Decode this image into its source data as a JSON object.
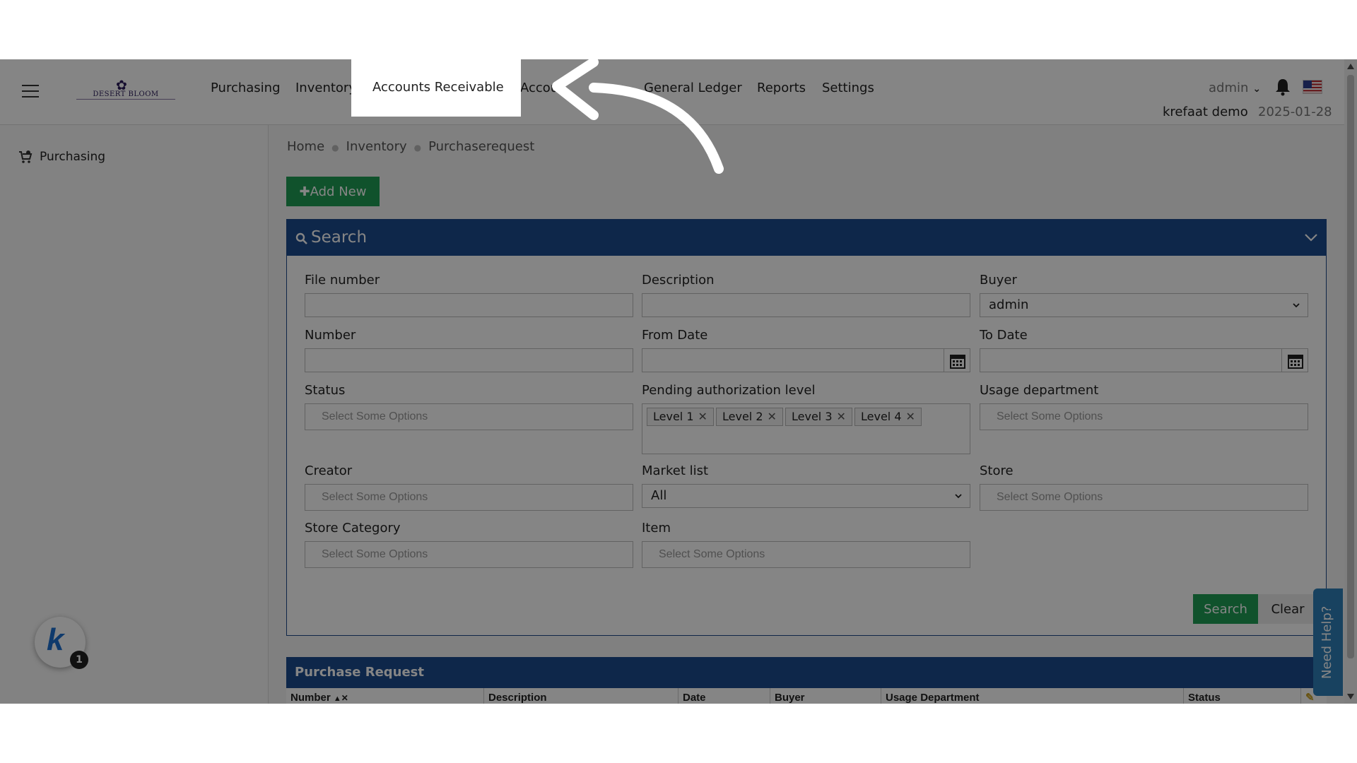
{
  "topbar": {
    "logo_text": "DESERT BLOOM",
    "nav": [
      "Purchasing",
      "Inventory",
      "Accounts Receivable",
      "Accou",
      "General Ledger",
      "Reports",
      "Settings"
    ],
    "highlighted": "Accounts Receivable",
    "user": "admin",
    "company": "krefaat demo",
    "date": "2025-01-28"
  },
  "sidebar": {
    "items": [
      {
        "label": "Purchasing",
        "icon": "cart-icon"
      }
    ]
  },
  "breadcrumb": [
    "Home",
    "Inventory",
    "Purchaserequest"
  ],
  "add_new_label": "Add New",
  "search": {
    "title": "Search",
    "fields": {
      "file_number": {
        "label": "File number",
        "value": ""
      },
      "description": {
        "label": "Description",
        "value": ""
      },
      "buyer": {
        "label": "Buyer",
        "value": "admin"
      },
      "number": {
        "label": "Number",
        "value": ""
      },
      "from_date": {
        "label": "From Date",
        "value": ""
      },
      "to_date": {
        "label": "To Date",
        "value": ""
      },
      "status": {
        "label": "Status",
        "placeholder": "Select Some Options"
      },
      "pending_level": {
        "label": "Pending authorization level",
        "tags": [
          "Level 1",
          "Level 2",
          "Level 3",
          "Level 4"
        ]
      },
      "usage_department": {
        "label": "Usage department",
        "placeholder": "Select Some Options"
      },
      "creator": {
        "label": "Creator",
        "placeholder": "Select Some Options"
      },
      "market_list": {
        "label": "Market list",
        "value": "All"
      },
      "store": {
        "label": "Store",
        "placeholder": "Select Some Options"
      },
      "store_category": {
        "label": "Store Category",
        "placeholder": "Select Some Options"
      },
      "item": {
        "label": "Item",
        "placeholder": "Select Some Options"
      }
    },
    "search_button": "Search",
    "clear_button": "Clear"
  },
  "purchase_request": {
    "title": "Purchase Request",
    "columns": [
      "Number",
      "Description",
      "Date",
      "Buyer",
      "Usage Department",
      "Status"
    ]
  },
  "need_help": "Need Help?",
  "badge_count": "1",
  "badge_letter": "k",
  "colors": {
    "panel_header": "#1c4b8e",
    "button_green": "#1f9d55",
    "help_tab": "#2e7fb8"
  }
}
